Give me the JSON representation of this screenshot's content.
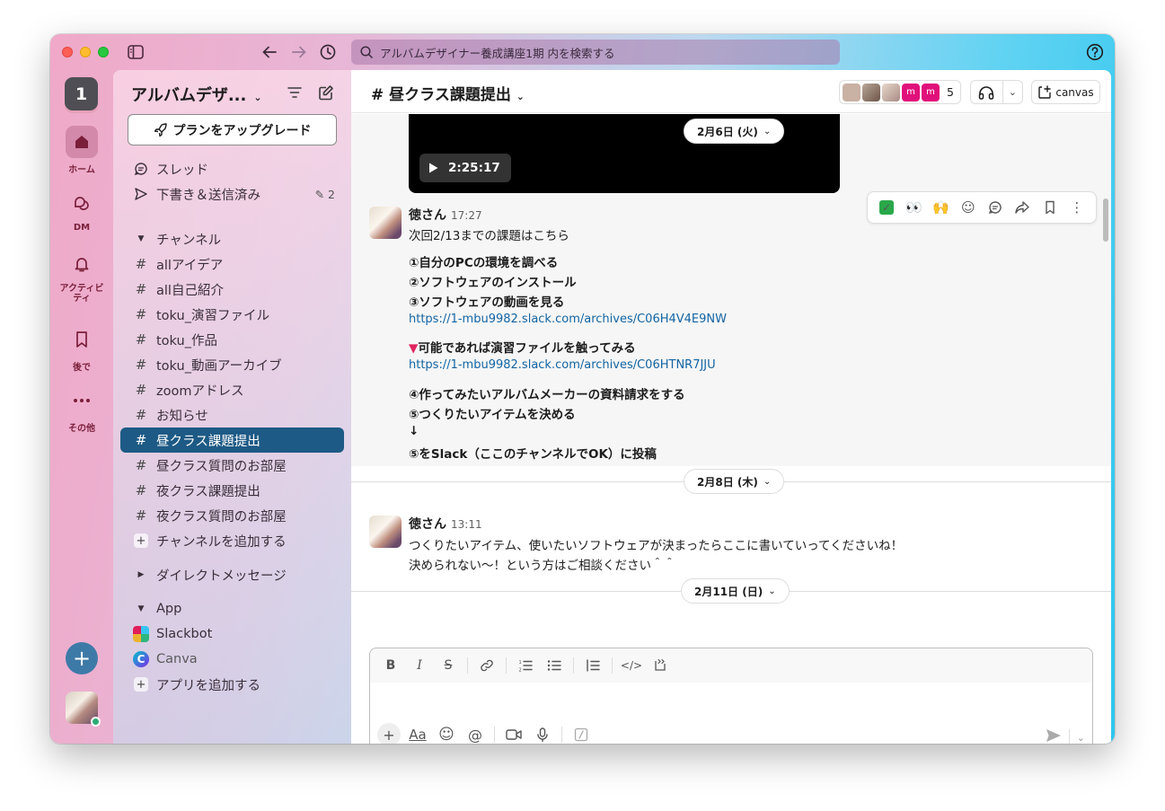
{
  "search": {
    "text": "アルバムデザイナー養成講座1期 内を検索する"
  },
  "rail": {
    "workspace_badge": "1",
    "items": [
      {
        "label": "ホーム",
        "icon": "home-icon"
      },
      {
        "label": "DM",
        "icon": "dm-icon"
      },
      {
        "label": "アクティビティ",
        "icon": "bell-icon"
      },
      {
        "label": "後で",
        "icon": "bookmark-icon"
      },
      {
        "label": "その他",
        "icon": "more-icon"
      }
    ]
  },
  "sidebar": {
    "workspace_name": "アルバムデザ...",
    "upgrade_label": "プランをアップグレード",
    "threads_label": "スレッド",
    "drafts_label": "下書き＆送信済み",
    "drafts_count": "2",
    "channels_header": "チャンネル",
    "channels": [
      "allアイデア",
      "all自己紹介",
      "toku_演習ファイル",
      "toku_作品",
      "toku_動画アーカイブ",
      "zoomアドレス",
      "お知らせ",
      "昼クラス課題提出",
      "昼クラス質問のお部屋",
      "夜クラス課題提出",
      "夜クラス質問のお部屋"
    ],
    "active_channel_index": 7,
    "add_channel_label": "チャンネルを追加する",
    "dm_header": "ダイレクトメッセージ",
    "app_header": "App",
    "apps": [
      "Slackbot",
      "Canva"
    ],
    "add_app_label": "アプリを追加する"
  },
  "channel": {
    "title": "昼クラス課題提出",
    "member_count": "5",
    "canvas_label": "canvas",
    "accent": "#1d5a85"
  },
  "messages": {
    "video_duration": "2:25:17",
    "date1": "2月6日 (火)",
    "msg1": {
      "author": "徳さん",
      "time": "17:27",
      "lines": [
        "次回2/13までの課題はこちら",
        "①自分のPCの環境を調べる",
        "②ソフトウェアのインストール",
        "③ソフトウェアの動画を見る",
        "https://1-mbu9982.slack.com/archives/C06H4V4E9NW",
        "可能であれば演習ファイルを触ってみる",
        "https://1-mbu9982.slack.com/archives/C06HTNR7JJU",
        "④作ってみたいアルバムメーカーの資料請求をする",
        "⑤つくりたいアイテムを決める",
        "↓",
        "⑤をSlack（ここのチャンネルでOK）に投稿"
      ]
    },
    "date2": "2月8日 (木)",
    "msg2": {
      "author": "徳さん",
      "time": "13:11",
      "lines": [
        "つくりたいアイテム、使いたいソフトウェアが決まったらここに書いていってくださいね！",
        "決められない〜！という方はご相談ください＾＾"
      ]
    },
    "date3": "2月11日 (日)"
  },
  "composer": {
    "placeholder": ""
  }
}
